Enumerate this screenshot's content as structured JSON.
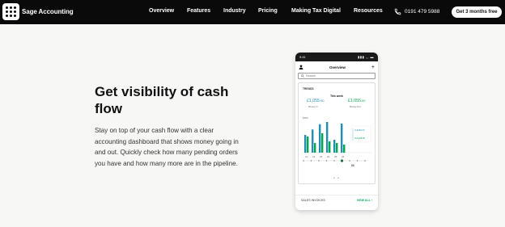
{
  "brand": {
    "name": "Sage Accounting"
  },
  "nav": {
    "links": [
      "Overview",
      "Features",
      "Industry",
      "Pricing",
      "Making Tax Digital",
      "Resources"
    ],
    "phone": "0191 479 5988",
    "cta": "Get 3 months free"
  },
  "hero": {
    "headline": "Get visibility of cash flow",
    "body": "Stay on top of your cash flow with a clear accounting dashboard that shows money going in and out. Quickly check how many pending orders you have and how many more are in the pipeline."
  },
  "phone": {
    "status_time": "9:41",
    "status_icons": "▮▮▮ ◡ ▬",
    "title": "Overview",
    "search_placeholder": "Search",
    "trends_label": "TRENDS",
    "week_label": "This week",
    "money_in": "£1,055",
    "money_in_pence": ".00",
    "money_in_label": "Money In",
    "money_out": "£1,055",
    "money_out_pence": ".00",
    "money_out_label": "Money Out",
    "sales_invoices": "SALES INVOICES",
    "view_all": "VIEW ALL"
  },
  "chart_data": {
    "type": "bar",
    "y_axis_label": "£500",
    "day_labels": [
      "21",
      "22",
      "23",
      "24",
      "25",
      "26"
    ],
    "selected_day_label": "24",
    "tooltip_in": "In  £290.00",
    "tooltip_out": "Out  £58.00",
    "series": [
      {
        "values": [
          0.55,
          0.72,
          0.88,
          0.95,
          0.4,
          0.9
        ]
      },
      {
        "values": [
          0.5,
          0.3,
          0.6,
          0.35,
          0.3,
          0.25
        ]
      }
    ],
    "colors": {
      "in": "#1f8fb3",
      "out": "#00a650"
    }
  },
  "colors": {
    "nav_bg": "#0a0a0a",
    "accent_green": "#00a650",
    "accent_blue": "#1f8fb3"
  }
}
